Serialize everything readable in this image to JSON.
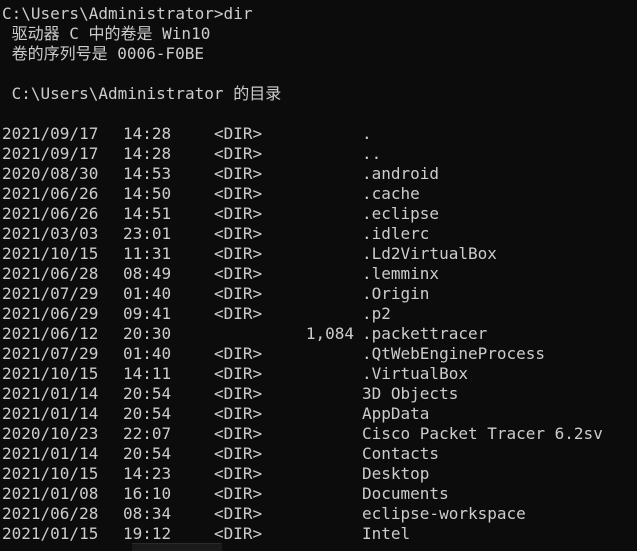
{
  "terminal": {
    "prompt_command": "C:\\Users\\Administrator>dir",
    "volume_line": " 驱动器 C 中的卷是 Win10",
    "serial_line": " 卷的序列号是 0006-F0BE",
    "directory_line": " C:\\Users\\Administrator 的目录",
    "colors": {
      "background": "#0c0c0c",
      "text": "#cccccc"
    },
    "entries": [
      {
        "date": "2021/09/17",
        "time": "14:28",
        "dir": "<DIR>",
        "size": "",
        "name": "."
      },
      {
        "date": "2021/09/17",
        "time": "14:28",
        "dir": "<DIR>",
        "size": "",
        "name": ".."
      },
      {
        "date": "2020/08/30",
        "time": "14:53",
        "dir": "<DIR>",
        "size": "",
        "name": ".android"
      },
      {
        "date": "2021/06/26",
        "time": "14:50",
        "dir": "<DIR>",
        "size": "",
        "name": ".cache"
      },
      {
        "date": "2021/06/26",
        "time": "14:51",
        "dir": "<DIR>",
        "size": "",
        "name": ".eclipse"
      },
      {
        "date": "2021/03/03",
        "time": "23:01",
        "dir": "<DIR>",
        "size": "",
        "name": ".idlerc"
      },
      {
        "date": "2021/10/15",
        "time": "11:31",
        "dir": "<DIR>",
        "size": "",
        "name": ".Ld2VirtualBox"
      },
      {
        "date": "2021/06/28",
        "time": "08:49",
        "dir": "<DIR>",
        "size": "",
        "name": ".lemminx"
      },
      {
        "date": "2021/07/29",
        "time": "01:40",
        "dir": "<DIR>",
        "size": "",
        "name": ".Origin"
      },
      {
        "date": "2021/06/29",
        "time": "09:41",
        "dir": "<DIR>",
        "size": "",
        "name": ".p2"
      },
      {
        "date": "2021/06/12",
        "time": "20:30",
        "dir": "",
        "size": "1,084",
        "name": ".packettracer"
      },
      {
        "date": "2021/07/29",
        "time": "01:40",
        "dir": "<DIR>",
        "size": "",
        "name": ".QtWebEngineProcess"
      },
      {
        "date": "2021/10/15",
        "time": "14:11",
        "dir": "<DIR>",
        "size": "",
        "name": ".VirtualBox"
      },
      {
        "date": "2021/01/14",
        "time": "20:54",
        "dir": "<DIR>",
        "size": "",
        "name": "3D Objects"
      },
      {
        "date": "2021/01/14",
        "time": "20:54",
        "dir": "<DIR>",
        "size": "",
        "name": "AppData"
      },
      {
        "date": "2020/10/23",
        "time": "22:07",
        "dir": "<DIR>",
        "size": "",
        "name": "Cisco Packet Tracer 6.2sv"
      },
      {
        "date": "2021/01/14",
        "time": "20:54",
        "dir": "<DIR>",
        "size": "",
        "name": "Contacts"
      },
      {
        "date": "2021/10/15",
        "time": "14:23",
        "dir": "<DIR>",
        "size": "",
        "name": "Desktop"
      },
      {
        "date": "2021/01/08",
        "time": "16:10",
        "dir": "<DIR>",
        "size": "",
        "name": "Documents"
      },
      {
        "date": "2021/06/28",
        "time": "08:34",
        "dir": "<DIR>",
        "size": "",
        "name": "eclipse-workspace"
      },
      {
        "date": "2021/01/15",
        "time": "19:12",
        "dir": "<DIR>",
        "size": "",
        "name": "Intel"
      }
    ]
  }
}
